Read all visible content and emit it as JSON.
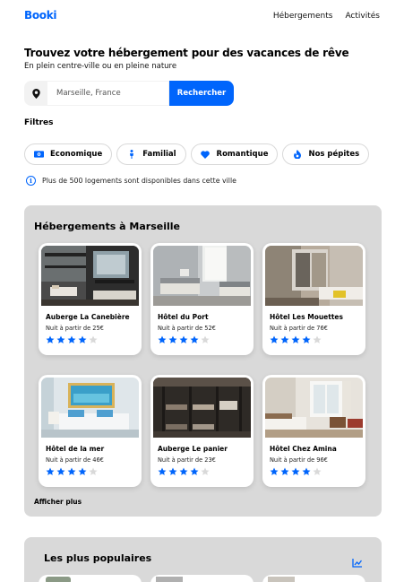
{
  "header": {
    "logo": "Booki",
    "nav": [
      "Hébergements",
      "Activités"
    ]
  },
  "hero": {
    "title": "Trouvez votre hébergement pour des vacances de rêve",
    "subtitle": "En plein centre-ville ou en pleine nature"
  },
  "search": {
    "placeholder": "Marseille, France",
    "button": "Rechercher",
    "icon": "location-pin-icon"
  },
  "filters": {
    "title": "Filtres",
    "chips": [
      {
        "label": "Economique",
        "icon": "money-icon"
      },
      {
        "label": "Familial",
        "icon": "child-icon"
      },
      {
        "label": "Romantique",
        "icon": "heart-icon"
      },
      {
        "label": "Nos pépites",
        "icon": "fire-icon"
      }
    ]
  },
  "info": {
    "text": "Plus de 500 logements sont disponibles dans cette ville"
  },
  "accommodations": {
    "title": "Hébergements à Marseille",
    "show_more": "Afficher plus",
    "cards": [
      {
        "name": "Auberge La Canebière",
        "price": "Nuit à partir de 25€",
        "rating": 4
      },
      {
        "name": "Hôtel du Port",
        "price": "Nuit à partir de 52€",
        "rating": 4
      },
      {
        "name": "Hôtel Les Mouettes",
        "price": "Nuit à partir de 76€",
        "rating": 4
      },
      {
        "name": "Hôtel de la mer",
        "price": "Nuit à partir de 46€",
        "rating": 4
      },
      {
        "name": "Auberge Le panier",
        "price": "Nuit à partir de 23€",
        "rating": 4
      },
      {
        "name": "Hôtel Chez Amina",
        "price": "Nuit à partir de 96€",
        "rating": 4
      }
    ]
  },
  "popular": {
    "title": "Les plus populaires",
    "icon": "trend-chart-icon"
  },
  "colors": {
    "accent": "#0065FC",
    "panel": "#D9D9D9",
    "star_off": "#D9D9D9"
  }
}
